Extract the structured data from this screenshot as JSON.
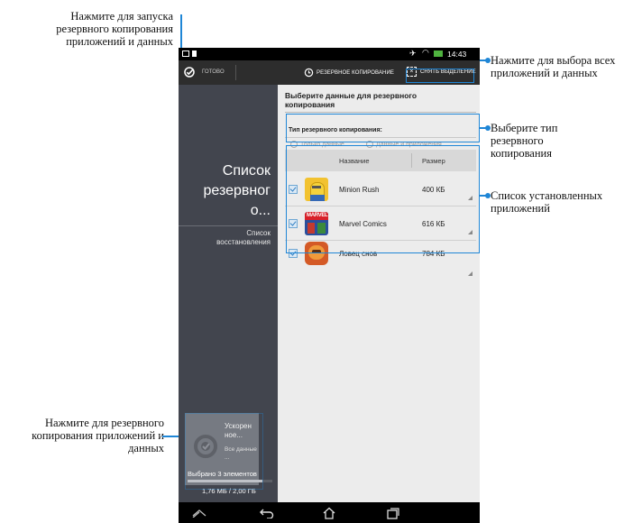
{
  "annotations": {
    "backup_apps": "Нажмите для запуска резервного копирования приложений и данных",
    "select_all": "Нажмите для выбора всех приложений и данных",
    "backup_type": "Выберите тип резервного копирования",
    "installed_list": "Список установленных приложений",
    "backup_tile": "Нажмите для резервного копирования приложений и данных"
  },
  "status_bar": {
    "time": "14:43"
  },
  "action_bar": {
    "done_label": "готово",
    "backup_label": "резервное копирование",
    "deselect_label": "снять выделение"
  },
  "left_panel": {
    "backup_list_title": "Список резервног о...",
    "restore_list": "Список восстановления",
    "tile_label": "Ускорен ное...",
    "tile_sub": "Все данные ...",
    "selected_count": "Выбрано 3 элементов",
    "storage": "1,76 МБ / 2,00 ГБ",
    "storage_fraction": 0.88
  },
  "right_panel": {
    "heading": "Выберите данные для резервного копирования",
    "backup_type_label": "Тип резервного копирования:",
    "option_data_only": "Только данные",
    "option_data_and_apps": "Данные и приложения",
    "col_name": "Название",
    "col_size": "Размер",
    "apps": [
      {
        "name": "Minion Rush",
        "size": "400 КБ",
        "checked": true,
        "icon": "minion-rush-icon"
      },
      {
        "name": "Marvel Comics",
        "size": "616 КБ",
        "checked": true,
        "icon": "marvel-comics-icon"
      },
      {
        "name": "Ловец снов",
        "size": "784 КБ",
        "checked": true,
        "icon": "dream-catcher-icon"
      }
    ]
  },
  "colors": {
    "accent": "#1f86d6",
    "left_panel": "#42454e",
    "action_bar": "#2d2d2d"
  }
}
